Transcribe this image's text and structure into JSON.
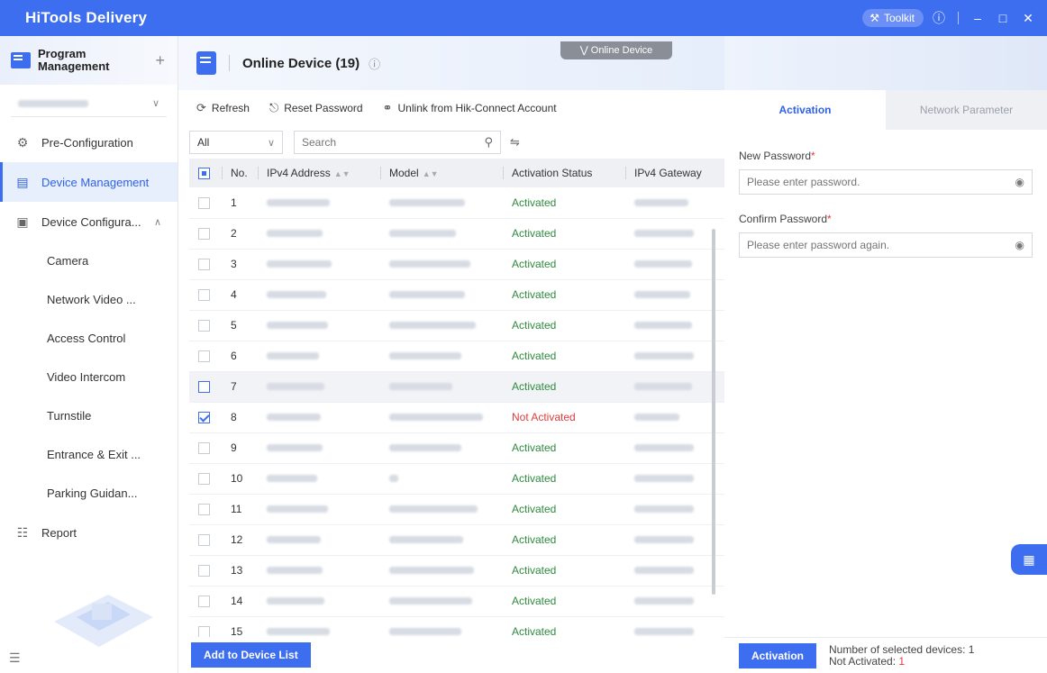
{
  "app": {
    "brand": "HiTools Delivery",
    "toolkit_label": "Toolkit"
  },
  "sidebar": {
    "program_title": "Program Management",
    "nav": {
      "pre_config": "Pre-Configuration",
      "device_mgmt": "Device Management",
      "device_config": "Device Configura...",
      "report": "Report"
    },
    "sub_items": [
      "Camera",
      "Network Video ...",
      "Access Control",
      "Video Intercom",
      "Turnstile",
      "Entrance & Exit ...",
      "Parking Guidan..."
    ]
  },
  "main": {
    "title": "Online Device",
    "count": "(19)",
    "online_device_tab": "Online Device",
    "toolbar": {
      "refresh": "Refresh",
      "reset_password": "Reset Password",
      "unlink": "Unlink from Hik-Connect Account"
    },
    "filter": {
      "selected": "All",
      "search_placeholder": "Search"
    },
    "columns": {
      "no": "No.",
      "ipv4": "IPv4 Address",
      "model": "Model",
      "status": "Activation Status",
      "gateway": "IPv4 Gateway"
    },
    "rows": [
      {
        "no": "1",
        "status": "Activated",
        "activated": true,
        "checked": false
      },
      {
        "no": "2",
        "status": "Activated",
        "activated": true,
        "checked": false
      },
      {
        "no": "3",
        "status": "Activated",
        "activated": true,
        "checked": false
      },
      {
        "no": "4",
        "status": "Activated",
        "activated": true,
        "checked": false
      },
      {
        "no": "5",
        "status": "Activated",
        "activated": true,
        "checked": false
      },
      {
        "no": "6",
        "status": "Activated",
        "activated": true,
        "checked": false
      },
      {
        "no": "7",
        "status": "Activated",
        "activated": true,
        "checked": false
      },
      {
        "no": "8",
        "status": "Not Activated",
        "activated": false,
        "checked": true
      },
      {
        "no": "9",
        "status": "Activated",
        "activated": true,
        "checked": false
      },
      {
        "no": "10",
        "status": "Activated",
        "activated": true,
        "checked": false
      },
      {
        "no": "11",
        "status": "Activated",
        "activated": true,
        "checked": false
      },
      {
        "no": "12",
        "status": "Activated",
        "activated": true,
        "checked": false
      },
      {
        "no": "13",
        "status": "Activated",
        "activated": true,
        "checked": false
      },
      {
        "no": "14",
        "status": "Activated",
        "activated": true,
        "checked": false
      },
      {
        "no": "15",
        "status": "Activated",
        "activated": true,
        "checked": false
      }
    ],
    "add_button": "Add to Device List"
  },
  "right": {
    "tabs": {
      "activation": "Activation",
      "network": "Network Parameter"
    },
    "new_password_label": "New Password",
    "new_password_placeholder": "Please enter password.",
    "confirm_password_label": "Confirm Password",
    "confirm_password_placeholder": "Please enter password again.",
    "activation_button": "Activation",
    "selected_info": "Number of selected devices: 1",
    "not_activated_label": "Not Activated:",
    "not_activated_count": "1"
  },
  "colors": {
    "accent": "#3e6ef0",
    "activated": "#2e8b3e",
    "not_activated": "#e23b3b"
  }
}
